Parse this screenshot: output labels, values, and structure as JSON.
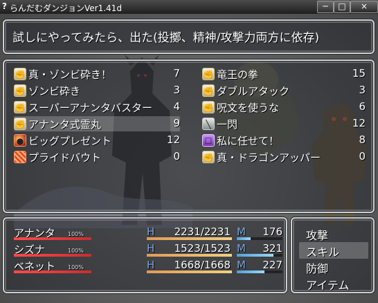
{
  "window": {
    "title": "らんだむダンジョンVer1.41d",
    "min": "─",
    "max": "□",
    "close": "×"
  },
  "help": {
    "text": "試しにやってみたら、出た(投擲、精神/攻撃力両方に依存)"
  },
  "skills_left": [
    {
      "name": "真・ゾンビ砕き！",
      "count": "7",
      "icon": "fist-icon"
    },
    {
      "name": "ゾンビ砕き",
      "count": "3",
      "icon": "fist-icon"
    },
    {
      "name": "スーパーアナンタバスター",
      "count": "4",
      "icon": "fist-icon"
    },
    {
      "name": "アナンタ式霊丸",
      "count": "9",
      "icon": "fist-icon",
      "selected": true
    },
    {
      "name": "ビッグプレゼント",
      "count": "12",
      "icon": "bomb-icon"
    },
    {
      "name": "プライドバウト",
      "count": "0",
      "icon": "pride-icon"
    }
  ],
  "skills_right": [
    {
      "name": "竜王の拳",
      "count": "15",
      "icon": "fist-icon"
    },
    {
      "name": "ダブルアタック",
      "count": "3",
      "icon": "fist-icon"
    },
    {
      "name": "呪文を使うな",
      "count": "6",
      "icon": "fist-icon"
    },
    {
      "name": "一閃",
      "count": "12",
      "icon": "sword-icon"
    },
    {
      "name": "私に任せて！",
      "count": "8",
      "icon": "book-icon"
    },
    {
      "name": "真・ドラゴンアッパー",
      "count": "0",
      "icon": "fist-icon"
    }
  ],
  "party": [
    {
      "name": "アナンタ",
      "state": "100%",
      "hp_label": "H",
      "hp": "2231/2231",
      "hp_ratio": 1.0,
      "mp_label": "M",
      "mp": "176",
      "mp_ratio": 0.3
    },
    {
      "name": "シズナ",
      "state": "100%",
      "hp_label": "H",
      "hp": "1523/1523",
      "hp_ratio": 1.0,
      "mp_label": "M",
      "mp": "321",
      "mp_ratio": 0.8
    },
    {
      "name": "ベネット",
      "state": "100%",
      "hp_label": "H",
      "hp": "1668/1668",
      "hp_ratio": 1.0,
      "mp_label": "M",
      "mp": "227",
      "mp_ratio": 0.6
    }
  ],
  "commands": [
    {
      "label": "攻撃"
    },
    {
      "label": "スキル",
      "selected": true
    },
    {
      "label": "防御"
    },
    {
      "label": "アイテム"
    }
  ]
}
